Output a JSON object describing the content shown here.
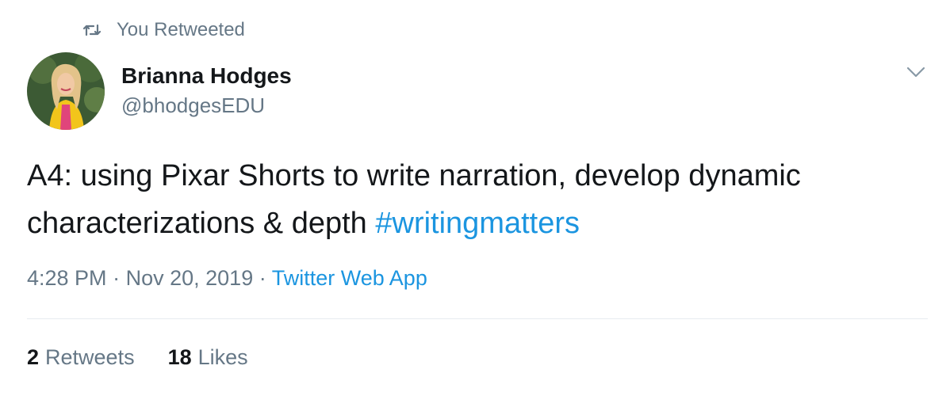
{
  "retweet_context": {
    "label": "You Retweeted",
    "icon": "retweet-icon"
  },
  "author": {
    "display_name": "Brianna Hodges",
    "handle": "@bhodgesEDU",
    "avatar_icon": "avatar-photo"
  },
  "menu": {
    "icon": "chevron-down-icon"
  },
  "tweet": {
    "text_main": "A4: using Pixar Shorts to write narration, develop dynamic characterizations & depth",
    "hashtag": "#writingmatters"
  },
  "meta": {
    "time": "4:28 PM",
    "separator": "·",
    "date": "Nov 20, 2019",
    "source": "Twitter Web App"
  },
  "stats": {
    "retweets_count": "2",
    "retweets_label": "Retweets",
    "likes_count": "18",
    "likes_label": "Likes"
  },
  "colors": {
    "text_primary": "#14171a",
    "text_secondary": "#657786",
    "link": "#1b95e0",
    "divider": "#e6ecf0",
    "background": "#ffffff"
  }
}
